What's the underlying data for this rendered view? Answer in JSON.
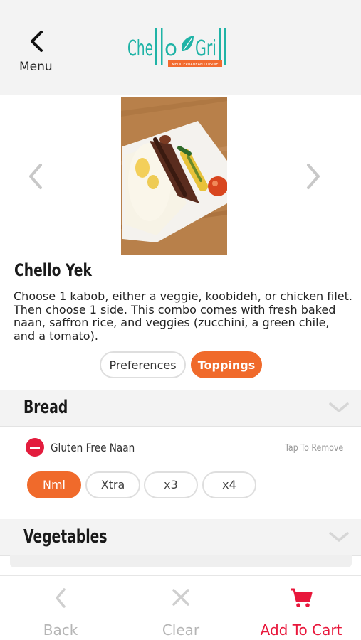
{
  "header": {
    "menu_label": "Menu",
    "logo_text": "Chello Grill",
    "logo_tagline": "MEDITERRANEAN CUISINE"
  },
  "item": {
    "title": "Chello Yek",
    "description": "Choose 1 kabob, either a veggie, koobideh, or chicken filet. Then choose 1 side. This combo comes with fresh baked naan, saffron rice, and veggies (zucchini, a green chile, and a tomato)."
  },
  "tabs": {
    "preferences": "Preferences",
    "toppings": "Toppings"
  },
  "sections": {
    "bread": {
      "title": "Bread",
      "option_name": "Gluten Free Naan",
      "remove_hint": "Tap To Remove",
      "quantities": [
        "Nml",
        "Xtra",
        "x3",
        "x4"
      ],
      "selected_quantity": "Nml"
    },
    "vegetables": {
      "title": "Vegetables"
    }
  },
  "bottom_bar": {
    "back": "Back",
    "clear": "Clear",
    "add_to_cart": "Add To Cart"
  },
  "colors": {
    "accent": "#f06a2b",
    "brand_teal": "#1fb3a6",
    "remove_red": "#e31c3d",
    "cart_red": "#e8173b",
    "disabled_gray": "#b5b5b5"
  }
}
